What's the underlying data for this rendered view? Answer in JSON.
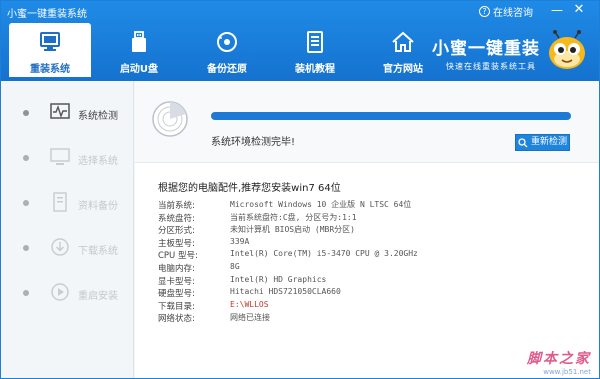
{
  "window": {
    "title": "小蜜一键重装系统",
    "online_label": "在线咨询",
    "minimize_glyph": "—",
    "close_glyph": "✕"
  },
  "nav": [
    {
      "label": "重装系统",
      "icon": "monitor-icon",
      "active": true
    },
    {
      "label": "启动U盘",
      "icon": "usb-icon",
      "active": false
    },
    {
      "label": "备份还原",
      "icon": "backup-icon",
      "active": false
    },
    {
      "label": "装机教程",
      "icon": "document-icon",
      "active": false
    },
    {
      "label": "官方网站",
      "icon": "home-icon",
      "active": false
    }
  ],
  "brand": {
    "name": "小蜜一键重装",
    "slogan": "快速在线重装系统工具"
  },
  "sidebar": [
    {
      "label": "系统检测",
      "icon": "pulse-monitor-icon",
      "active": true
    },
    {
      "label": "选择系统",
      "icon": "desktop-icon",
      "active": false
    },
    {
      "label": "资料备份",
      "icon": "file-icon",
      "active": false
    },
    {
      "label": "下载系统",
      "icon": "download-icon",
      "active": false
    },
    {
      "label": "重启安装",
      "icon": "play-icon",
      "active": false
    }
  ],
  "progress": {
    "percent": 100,
    "status": "系统环境检测完毕!",
    "recheck_label": "重新检测"
  },
  "recommend": "根据您的电脑配件,推荐您安装win7 64位",
  "info": [
    {
      "key": "当前系统:",
      "value": "Microsoft Windows 10 企业版 N LTSC  64位"
    },
    {
      "key": "系统盘符:",
      "value": "当前系统盘符:C盘, 分区号为:1:1"
    },
    {
      "key": "分区形式:",
      "value": "未知计算机 BIOS启动 (MBR分区)"
    },
    {
      "key": "主板型号:",
      "value": "339A"
    },
    {
      "key": "CPU 型号:",
      "value": "Intel(R) Core(TM) i5-3470 CPU @ 3.20GHz"
    },
    {
      "key": "电脑内存:",
      "value": "8G"
    },
    {
      "key": "显卡型号:",
      "value": "Intel(R) HD Graphics"
    },
    {
      "key": "硬盘型号:",
      "value": "Hitachi HDS721050CLA660"
    },
    {
      "key": "下载目录:",
      "value": "E:\\WLLOS",
      "highlight": true
    },
    {
      "key": "网络状态:",
      "value": "网络已连接"
    }
  ],
  "watermark": {
    "big": "脚本之家",
    "small": "www.jb51.net"
  },
  "colors": {
    "header_blue": "#1a7fdc",
    "accent": "#1c7ad6",
    "path_red": "#c0392b"
  }
}
